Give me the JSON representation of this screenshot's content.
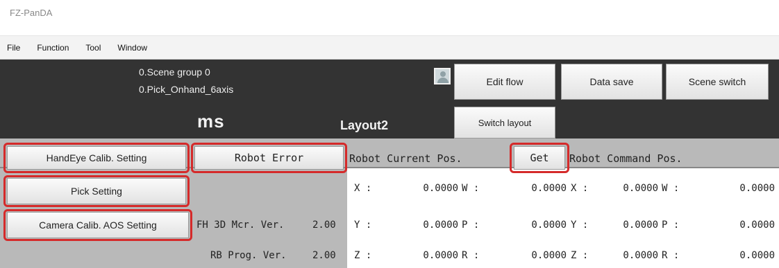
{
  "window": {
    "title": "FZ-PanDA"
  },
  "menu": {
    "items": [
      "File",
      "Function",
      "Tool",
      "Window"
    ]
  },
  "scene": {
    "group": "0.Scene group 0",
    "name": "0.Pick_Onhand_6axis",
    "time_unit": "ms",
    "layout": "Layout2"
  },
  "toolbar": {
    "edit_flow": "Edit flow",
    "data_save": "Data save",
    "scene_switch": "Scene switch",
    "switch_layout": "Switch layout"
  },
  "settings": {
    "handeye": "HandEye Calib. Setting",
    "pick": "Pick Setting",
    "camera": "Camera Calib. AOS  Setting",
    "robot_error": "Robot Error"
  },
  "versions": {
    "fh_label": "FH 3D Mcr. Ver.",
    "fh_value": "2.00",
    "rb_label": "RB Prog. Ver.",
    "rb_value": "2.00"
  },
  "current_pos": {
    "header": "Robot Current Pos.",
    "get_label": "Get",
    "rows": [
      {
        "a_label": "X :",
        "a_value": "0.0000",
        "b_label": "W :",
        "b_value": "0.0000"
      },
      {
        "a_label": "Y :",
        "a_value": "0.0000",
        "b_label": "P :",
        "b_value": "0.0000"
      },
      {
        "a_label": "Z :",
        "a_value": "0.0000",
        "b_label": "R :",
        "b_value": "0.0000"
      }
    ]
  },
  "command_pos": {
    "header": "Robot Command Pos.",
    "rows": [
      {
        "a_label": "X :",
        "a_value": "0.0000",
        "b_label": "W :",
        "b_value": "0.0000"
      },
      {
        "a_label": "Y :",
        "a_value": "0.0000",
        "b_label": "P :",
        "b_value": "0.0000"
      },
      {
        "a_label": "Z :",
        "a_value": "0.0000",
        "b_label": "R :",
        "b_value": "0.0000"
      }
    ]
  }
}
